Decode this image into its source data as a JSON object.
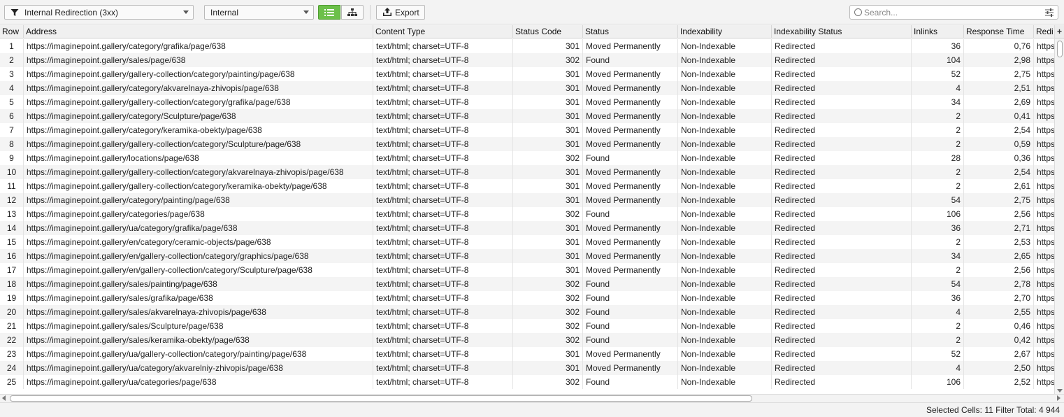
{
  "toolbar": {
    "filter_value": "Internal Redirection (3xx)",
    "scope_value": "Internal",
    "export_label": "Export",
    "search_placeholder": "Search...",
    "active_view": "list",
    "accent_color": "#6cc04a"
  },
  "table": {
    "columns": [
      "Row",
      "Address",
      "Content Type",
      "Status Code",
      "Status",
      "Indexability",
      "Indexability Status",
      "Inlinks",
      "Response Time",
      "Redi"
    ],
    "rows": [
      [
        "1",
        "https://imaginepoint.gallery/category/grafika/page/638",
        "text/html; charset=UTF-8",
        "301",
        "Moved Permanently",
        "Non-Indexable",
        "Redirected",
        "36",
        "0,76",
        "https"
      ],
      [
        "2",
        "https://imaginepoint.gallery/sales/page/638",
        "text/html; charset=UTF-8",
        "302",
        "Found",
        "Non-Indexable",
        "Redirected",
        "104",
        "2,98",
        "https"
      ],
      [
        "3",
        "https://imaginepoint.gallery/gallery-collection/category/painting/page/638",
        "text/html; charset=UTF-8",
        "301",
        "Moved Permanently",
        "Non-Indexable",
        "Redirected",
        "52",
        "2,75",
        "https"
      ],
      [
        "4",
        "https://imaginepoint.gallery/category/akvarelnaya-zhivopis/page/638",
        "text/html; charset=UTF-8",
        "301",
        "Moved Permanently",
        "Non-Indexable",
        "Redirected",
        "4",
        "2,51",
        "https"
      ],
      [
        "5",
        "https://imaginepoint.gallery/gallery-collection/category/grafika/page/638",
        "text/html; charset=UTF-8",
        "301",
        "Moved Permanently",
        "Non-Indexable",
        "Redirected",
        "34",
        "2,69",
        "https"
      ],
      [
        "6",
        "https://imaginepoint.gallery/category/Sculpture/page/638",
        "text/html; charset=UTF-8",
        "301",
        "Moved Permanently",
        "Non-Indexable",
        "Redirected",
        "2",
        "0,41",
        "https"
      ],
      [
        "7",
        "https://imaginepoint.gallery/category/keramika-obekty/page/638",
        "text/html; charset=UTF-8",
        "301",
        "Moved Permanently",
        "Non-Indexable",
        "Redirected",
        "2",
        "2,54",
        "https"
      ],
      [
        "8",
        "https://imaginepoint.gallery/gallery-collection/category/Sculpture/page/638",
        "text/html; charset=UTF-8",
        "301",
        "Moved Permanently",
        "Non-Indexable",
        "Redirected",
        "2",
        "0,59",
        "https"
      ],
      [
        "9",
        "https://imaginepoint.gallery/locations/page/638",
        "text/html; charset=UTF-8",
        "302",
        "Found",
        "Non-Indexable",
        "Redirected",
        "28",
        "0,36",
        "https"
      ],
      [
        "10",
        "https://imaginepoint.gallery/gallery-collection/category/akvarelnaya-zhivopis/page/638",
        "text/html; charset=UTF-8",
        "301",
        "Moved Permanently",
        "Non-Indexable",
        "Redirected",
        "2",
        "2,54",
        "https"
      ],
      [
        "11",
        "https://imaginepoint.gallery/gallery-collection/category/keramika-obekty/page/638",
        "text/html; charset=UTF-8",
        "301",
        "Moved Permanently",
        "Non-Indexable",
        "Redirected",
        "2",
        "2,61",
        "https"
      ],
      [
        "12",
        "https://imaginepoint.gallery/category/painting/page/638",
        "text/html; charset=UTF-8",
        "301",
        "Moved Permanently",
        "Non-Indexable",
        "Redirected",
        "54",
        "2,75",
        "https"
      ],
      [
        "13",
        "https://imaginepoint.gallery/categories/page/638",
        "text/html; charset=UTF-8",
        "302",
        "Found",
        "Non-Indexable",
        "Redirected",
        "106",
        "2,56",
        "https"
      ],
      [
        "14",
        "https://imaginepoint.gallery/ua/category/grafika/page/638",
        "text/html; charset=UTF-8",
        "301",
        "Moved Permanently",
        "Non-Indexable",
        "Redirected",
        "36",
        "2,71",
        "https"
      ],
      [
        "15",
        "https://imaginepoint.gallery/en/category/ceramic-objects/page/638",
        "text/html; charset=UTF-8",
        "301",
        "Moved Permanently",
        "Non-Indexable",
        "Redirected",
        "2",
        "2,53",
        "https"
      ],
      [
        "16",
        "https://imaginepoint.gallery/en/gallery-collection/category/graphics/page/638",
        "text/html; charset=UTF-8",
        "301",
        "Moved Permanently",
        "Non-Indexable",
        "Redirected",
        "34",
        "2,65",
        "https"
      ],
      [
        "17",
        "https://imaginepoint.gallery/en/gallery-collection/category/Sculpture/page/638",
        "text/html; charset=UTF-8",
        "301",
        "Moved Permanently",
        "Non-Indexable",
        "Redirected",
        "2",
        "2,56",
        "https"
      ],
      [
        "18",
        "https://imaginepoint.gallery/sales/painting/page/638",
        "text/html; charset=UTF-8",
        "302",
        "Found",
        "Non-Indexable",
        "Redirected",
        "54",
        "2,78",
        "https"
      ],
      [
        "19",
        "https://imaginepoint.gallery/sales/grafika/page/638",
        "text/html; charset=UTF-8",
        "302",
        "Found",
        "Non-Indexable",
        "Redirected",
        "36",
        "2,70",
        "https"
      ],
      [
        "20",
        "https://imaginepoint.gallery/sales/akvarelnaya-zhivopis/page/638",
        "text/html; charset=UTF-8",
        "302",
        "Found",
        "Non-Indexable",
        "Redirected",
        "4",
        "2,55",
        "https"
      ],
      [
        "21",
        "https://imaginepoint.gallery/sales/Sculpture/page/638",
        "text/html; charset=UTF-8",
        "302",
        "Found",
        "Non-Indexable",
        "Redirected",
        "2",
        "0,46",
        "https"
      ],
      [
        "22",
        "https://imaginepoint.gallery/sales/keramika-obekty/page/638",
        "text/html; charset=UTF-8",
        "302",
        "Found",
        "Non-Indexable",
        "Redirected",
        "2",
        "0,42",
        "https"
      ],
      [
        "23",
        "https://imaginepoint.gallery/ua/gallery-collection/category/painting/page/638",
        "text/html; charset=UTF-8",
        "301",
        "Moved Permanently",
        "Non-Indexable",
        "Redirected",
        "52",
        "2,67",
        "https"
      ],
      [
        "24",
        "https://imaginepoint.gallery/ua/category/akvarelniy-zhivopis/page/638",
        "text/html; charset=UTF-8",
        "301",
        "Moved Permanently",
        "Non-Indexable",
        "Redirected",
        "4",
        "2,50",
        "https"
      ],
      [
        "25",
        "https://imaginepoint.gallery/ua/categories/page/638",
        "text/html; charset=UTF-8",
        "302",
        "Found",
        "Non-Indexable",
        "Redirected",
        "106",
        "2,52",
        "https"
      ]
    ]
  },
  "statusbar": {
    "selected_label": "Selected Cells:",
    "selected_value": "11",
    "filter_label": "Filter Total:",
    "filter_value": "4 944"
  },
  "icons": {
    "add_column": "+"
  }
}
